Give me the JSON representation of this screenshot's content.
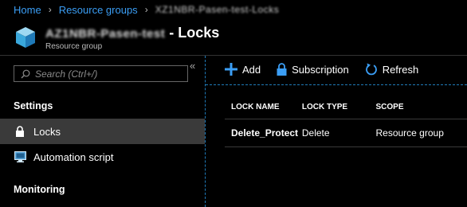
{
  "breadcrumb": {
    "home": "Home",
    "resource_groups": "Resource groups",
    "current": "XZ1NBR-Pasen-test-Locks"
  },
  "header": {
    "resource_name": "AZ1NBR-Pasen-test",
    "title_suffix": "- Locks",
    "subtitle": "Resource group"
  },
  "sidebar": {
    "collapse_glyph": "«",
    "search_placeholder": "Search (Ctrl+/)",
    "sections": {
      "settings": "Settings",
      "monitoring": "Monitoring"
    },
    "items": [
      {
        "label": "Locks",
        "icon": "lock-icon",
        "active": true
      },
      {
        "label": "Automation script",
        "icon": "automation-script-icon",
        "active": false
      }
    ]
  },
  "toolbar": {
    "add": "Add",
    "subscription": "Subscription",
    "refresh": "Refresh"
  },
  "table": {
    "columns": [
      "LOCK NAME",
      "LOCK TYPE",
      "SCOPE"
    ],
    "rows": [
      {
        "name": "Delete_Protect",
        "type": "Delete",
        "scope": "Resource group"
      }
    ]
  },
  "colors": {
    "accent": "#3b9ef5",
    "background": "#000000",
    "active_item": "#3a3a3a"
  }
}
